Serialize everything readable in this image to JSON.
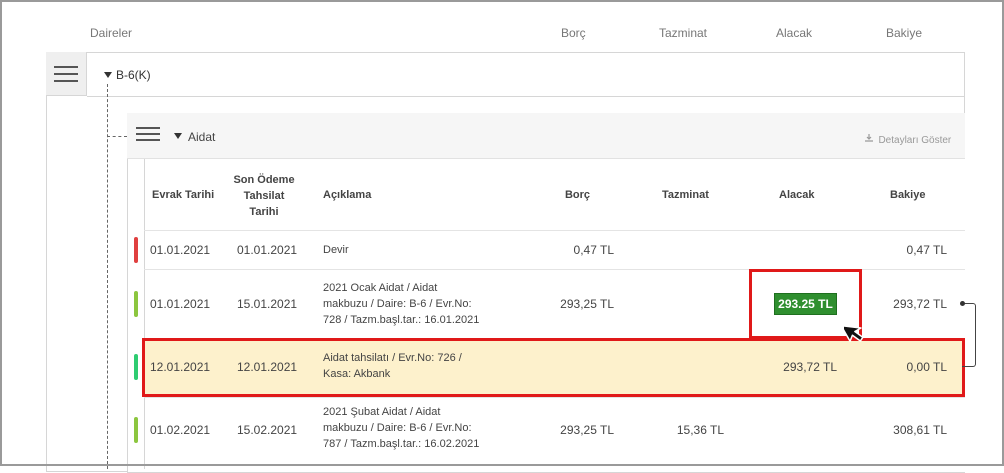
{
  "columns": {
    "daireler": "Daireler",
    "borc": "Borç",
    "tazminat": "Tazminat",
    "alacak": "Alacak",
    "bakiye": "Bakiye"
  },
  "unit": {
    "name": "B-6(K)"
  },
  "group": {
    "name": "Aidat",
    "details_link": "Detayları Göster"
  },
  "table": {
    "headers": {
      "evrak_tarihi": "Evrak Tarihi",
      "son_odeme": "Son Ödeme Tahsilat Tarihi",
      "aciklama": "Açıklama",
      "borc": "Borç",
      "tazminat": "Tazminat",
      "alacak": "Alacak",
      "bakiye": "Bakiye"
    },
    "rows": [
      {
        "evrak": "01.01.2021",
        "son": "01.01.2021",
        "desc": [
          "Devir"
        ],
        "borc": "0,47 TL",
        "tazminat": "",
        "alacak": "",
        "bakiye": "0,47 TL",
        "status_color": "#e04040"
      },
      {
        "evrak": "01.01.2021",
        "son": "15.01.2021",
        "desc": [
          "2021 Ocak Aidat / Aidat",
          "makbuzu / Daire: B-6 / Evr.No:",
          "728 / Tazm.başl.tar.: 16.01.2021"
        ],
        "borc": "293,25 TL",
        "tazminat": "",
        "alacak": "293.25 TL",
        "bakiye": "293,72 TL",
        "status_color": "#8cc63f"
      },
      {
        "evrak": "12.01.2021",
        "son": "12.01.2021",
        "desc": [
          "Aidat tahsilatı / Evr.No: 726 /",
          "Kasa: Akbank"
        ],
        "borc": "",
        "tazminat": "",
        "alacak": "293,72 TL",
        "bakiye": "0,00 TL",
        "status_color": "#2ecc71"
      },
      {
        "evrak": "01.02.2021",
        "son": "15.02.2021",
        "desc": [
          "2021 Şubat Aidat / Aidat",
          "makbuzu / Daire: B-6 / Evr.No:",
          "787 / Tazm.başl.tar.: 16.02.2021"
        ],
        "borc": "293,25 TL",
        "tazminat": "15,36 TL",
        "alacak": "",
        "bakiye": "308,61 TL",
        "status_color": "#8cc63f"
      }
    ]
  },
  "icons": {
    "menu": "menu-icon",
    "download": "download-icon",
    "cursor": "mouse-cursor-icon",
    "collapse": "caret-down-icon"
  },
  "colors": {
    "highlight_red": "#e01919",
    "badge_green": "#2f8f2f",
    "selected_row": "#fdf1cc"
  }
}
